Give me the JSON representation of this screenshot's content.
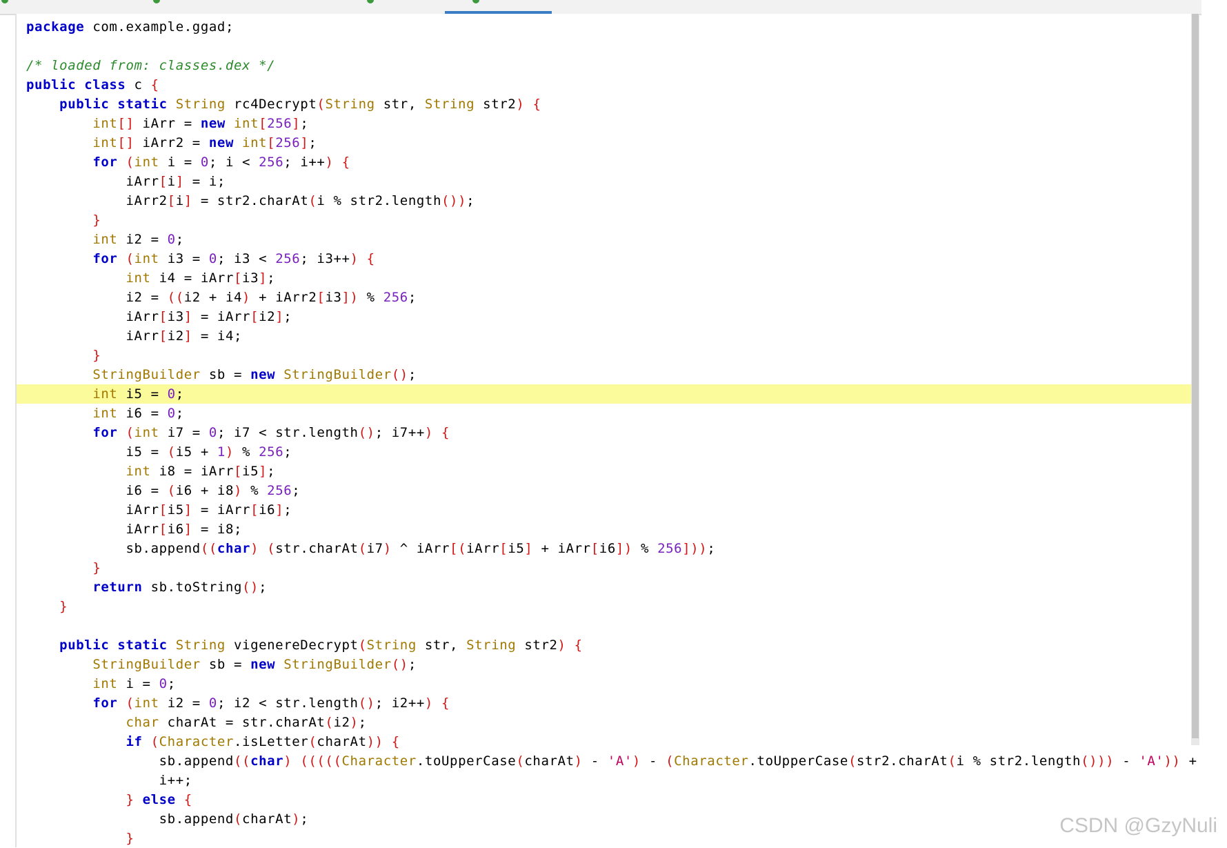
{
  "colors": {
    "keyword": "#0000c8",
    "type": "#a07800",
    "number": "#7a1fc2",
    "bracket": "#d21414",
    "string": "#c0005c",
    "comment": "#2b8a2b",
    "highlight": "#fbfb9c",
    "active_tab": "#3b7dc4"
  },
  "tabs": [
    {
      "icon": "class-file-icon",
      "active": false
    },
    {
      "icon": "class-file-icon",
      "active": false
    },
    {
      "icon": "class-file-icon",
      "active": false
    },
    {
      "icon": "class-file-icon",
      "active": true
    }
  ],
  "editor": {
    "highlighted_line": 20,
    "lines": [
      [
        [
          "kw",
          "package"
        ],
        [
          "plain",
          " com.example.ggad;"
        ]
      ],
      [],
      [
        [
          "cm",
          "/* loaded from: classes.dex */"
        ]
      ],
      [
        [
          "kw",
          "public class"
        ],
        [
          "plain",
          " c "
        ],
        [
          "br",
          "{"
        ]
      ],
      [
        [
          "plain",
          "    "
        ],
        [
          "kw",
          "public static"
        ],
        [
          "plain",
          " "
        ],
        [
          "ty",
          "String"
        ],
        [
          "plain",
          " rc4Decrypt"
        ],
        [
          "br",
          "("
        ],
        [
          "ty",
          "String"
        ],
        [
          "plain",
          " str, "
        ],
        [
          "ty",
          "String"
        ],
        [
          "plain",
          " str2"
        ],
        [
          "br",
          ")"
        ],
        [
          "plain",
          " "
        ],
        [
          "br",
          "{"
        ]
      ],
      [
        [
          "plain",
          "        "
        ],
        [
          "ty",
          "int"
        ],
        [
          "br",
          "[]"
        ],
        [
          "plain",
          " iArr = "
        ],
        [
          "kw",
          "new"
        ],
        [
          "plain",
          " "
        ],
        [
          "ty",
          "int"
        ],
        [
          "br",
          "["
        ],
        [
          "num",
          "256"
        ],
        [
          "br",
          "]"
        ],
        [
          "plain",
          ";"
        ]
      ],
      [
        [
          "plain",
          "        "
        ],
        [
          "ty",
          "int"
        ],
        [
          "br",
          "[]"
        ],
        [
          "plain",
          " iArr2 = "
        ],
        [
          "kw",
          "new"
        ],
        [
          "plain",
          " "
        ],
        [
          "ty",
          "int"
        ],
        [
          "br",
          "["
        ],
        [
          "num",
          "256"
        ],
        [
          "br",
          "]"
        ],
        [
          "plain",
          ";"
        ]
      ],
      [
        [
          "plain",
          "        "
        ],
        [
          "kw",
          "for"
        ],
        [
          "plain",
          " "
        ],
        [
          "br",
          "("
        ],
        [
          "ty",
          "int"
        ],
        [
          "plain",
          " i = "
        ],
        [
          "num",
          "0"
        ],
        [
          "plain",
          "; i < "
        ],
        [
          "num",
          "256"
        ],
        [
          "plain",
          "; i++"
        ],
        [
          "br",
          ")"
        ],
        [
          "plain",
          " "
        ],
        [
          "br",
          "{"
        ]
      ],
      [
        [
          "plain",
          "            iArr"
        ],
        [
          "br",
          "["
        ],
        [
          "plain",
          "i"
        ],
        [
          "br",
          "]"
        ],
        [
          "plain",
          " = i;"
        ]
      ],
      [
        [
          "plain",
          "            iArr2"
        ],
        [
          "br",
          "["
        ],
        [
          "plain",
          "i"
        ],
        [
          "br",
          "]"
        ],
        [
          "plain",
          " = str2.charAt"
        ],
        [
          "br",
          "("
        ],
        [
          "plain",
          "i % str2.length"
        ],
        [
          "br",
          "())"
        ],
        [
          "plain",
          ";"
        ]
      ],
      [
        [
          "plain",
          "        "
        ],
        [
          "br",
          "}"
        ]
      ],
      [
        [
          "plain",
          "        "
        ],
        [
          "ty",
          "int"
        ],
        [
          "plain",
          " i2 = "
        ],
        [
          "num",
          "0"
        ],
        [
          "plain",
          ";"
        ]
      ],
      [
        [
          "plain",
          "        "
        ],
        [
          "kw",
          "for"
        ],
        [
          "plain",
          " "
        ],
        [
          "br",
          "("
        ],
        [
          "ty",
          "int"
        ],
        [
          "plain",
          " i3 = "
        ],
        [
          "num",
          "0"
        ],
        [
          "plain",
          "; i3 < "
        ],
        [
          "num",
          "256"
        ],
        [
          "plain",
          "; i3++"
        ],
        [
          "br",
          ")"
        ],
        [
          "plain",
          " "
        ],
        [
          "br",
          "{"
        ]
      ],
      [
        [
          "plain",
          "            "
        ],
        [
          "ty",
          "int"
        ],
        [
          "plain",
          " i4 = iArr"
        ],
        [
          "br",
          "["
        ],
        [
          "plain",
          "i3"
        ],
        [
          "br",
          "]"
        ],
        [
          "plain",
          ";"
        ]
      ],
      [
        [
          "plain",
          "            i2 = "
        ],
        [
          "br",
          "(("
        ],
        [
          "plain",
          "i2 + i4"
        ],
        [
          "br",
          ")"
        ],
        [
          "plain",
          " + iArr2"
        ],
        [
          "br",
          "["
        ],
        [
          "plain",
          "i3"
        ],
        [
          "br",
          "])"
        ],
        [
          "plain",
          " % "
        ],
        [
          "num",
          "256"
        ],
        [
          "plain",
          ";"
        ]
      ],
      [
        [
          "plain",
          "            iArr"
        ],
        [
          "br",
          "["
        ],
        [
          "plain",
          "i3"
        ],
        [
          "br",
          "]"
        ],
        [
          "plain",
          " = iArr"
        ],
        [
          "br",
          "["
        ],
        [
          "plain",
          "i2"
        ],
        [
          "br",
          "]"
        ],
        [
          "plain",
          ";"
        ]
      ],
      [
        [
          "plain",
          "            iArr"
        ],
        [
          "br",
          "["
        ],
        [
          "plain",
          "i2"
        ],
        [
          "br",
          "]"
        ],
        [
          "plain",
          " = i4;"
        ]
      ],
      [
        [
          "plain",
          "        "
        ],
        [
          "br",
          "}"
        ]
      ],
      [
        [
          "plain",
          "        "
        ],
        [
          "ty",
          "StringBuilder"
        ],
        [
          "plain",
          " sb = "
        ],
        [
          "kw",
          "new"
        ],
        [
          "plain",
          " "
        ],
        [
          "ty",
          "StringBuilder"
        ],
        [
          "br",
          "()"
        ],
        [
          "plain",
          ";"
        ]
      ],
      [
        [
          "plain",
          "        "
        ],
        [
          "ty",
          "int"
        ],
        [
          "plain",
          " i5 = "
        ],
        [
          "num",
          "0"
        ],
        [
          "plain",
          ";"
        ]
      ],
      [
        [
          "plain",
          "        "
        ],
        [
          "ty",
          "int"
        ],
        [
          "plain",
          " i6 = "
        ],
        [
          "num",
          "0"
        ],
        [
          "plain",
          ";"
        ]
      ],
      [
        [
          "plain",
          "        "
        ],
        [
          "kw",
          "for"
        ],
        [
          "plain",
          " "
        ],
        [
          "br",
          "("
        ],
        [
          "ty",
          "int"
        ],
        [
          "plain",
          " i7 = "
        ],
        [
          "num",
          "0"
        ],
        [
          "plain",
          "; i7 < str.length"
        ],
        [
          "br",
          "()"
        ],
        [
          "plain",
          "; i7++"
        ],
        [
          "br",
          ")"
        ],
        [
          "plain",
          " "
        ],
        [
          "br",
          "{"
        ]
      ],
      [
        [
          "plain",
          "            i5 = "
        ],
        [
          "br",
          "("
        ],
        [
          "plain",
          "i5 + "
        ],
        [
          "num",
          "1"
        ],
        [
          "br",
          ")"
        ],
        [
          "plain",
          " % "
        ],
        [
          "num",
          "256"
        ],
        [
          "plain",
          ";"
        ]
      ],
      [
        [
          "plain",
          "            "
        ],
        [
          "ty",
          "int"
        ],
        [
          "plain",
          " i8 = iArr"
        ],
        [
          "br",
          "["
        ],
        [
          "plain",
          "i5"
        ],
        [
          "br",
          "]"
        ],
        [
          "plain",
          ";"
        ]
      ],
      [
        [
          "plain",
          "            i6 = "
        ],
        [
          "br",
          "("
        ],
        [
          "plain",
          "i6 + i8"
        ],
        [
          "br",
          ")"
        ],
        [
          "plain",
          " % "
        ],
        [
          "num",
          "256"
        ],
        [
          "plain",
          ";"
        ]
      ],
      [
        [
          "plain",
          "            iArr"
        ],
        [
          "br",
          "["
        ],
        [
          "plain",
          "i5"
        ],
        [
          "br",
          "]"
        ],
        [
          "plain",
          " = iArr"
        ],
        [
          "br",
          "["
        ],
        [
          "plain",
          "i6"
        ],
        [
          "br",
          "]"
        ],
        [
          "plain",
          ";"
        ]
      ],
      [
        [
          "plain",
          "            iArr"
        ],
        [
          "br",
          "["
        ],
        [
          "plain",
          "i6"
        ],
        [
          "br",
          "]"
        ],
        [
          "plain",
          " = i8;"
        ]
      ],
      [
        [
          "plain",
          "            sb.append"
        ],
        [
          "br",
          "(("
        ],
        [
          "kw",
          "char"
        ],
        [
          "br",
          ")"
        ],
        [
          "plain",
          " "
        ],
        [
          "br",
          "("
        ],
        [
          "plain",
          "str.charAt"
        ],
        [
          "br",
          "("
        ],
        [
          "plain",
          "i7"
        ],
        [
          "br",
          ")"
        ],
        [
          "plain",
          " ^ iArr"
        ],
        [
          "br",
          "[("
        ],
        [
          "plain",
          "iArr"
        ],
        [
          "br",
          "["
        ],
        [
          "plain",
          "i5"
        ],
        [
          "br",
          "]"
        ],
        [
          "plain",
          " + iArr"
        ],
        [
          "br",
          "["
        ],
        [
          "plain",
          "i6"
        ],
        [
          "br",
          "])"
        ],
        [
          "plain",
          " % "
        ],
        [
          "num",
          "256"
        ],
        [
          "br",
          "]))"
        ],
        [
          "plain",
          ";"
        ]
      ],
      [
        [
          "plain",
          "        "
        ],
        [
          "br",
          "}"
        ]
      ],
      [
        [
          "plain",
          "        "
        ],
        [
          "kw",
          "return"
        ],
        [
          "plain",
          " sb.toString"
        ],
        [
          "br",
          "()"
        ],
        [
          "plain",
          ";"
        ]
      ],
      [
        [
          "plain",
          "    "
        ],
        [
          "br",
          "}"
        ]
      ],
      [],
      [
        [
          "plain",
          "    "
        ],
        [
          "kw",
          "public static"
        ],
        [
          "plain",
          " "
        ],
        [
          "ty",
          "String"
        ],
        [
          "plain",
          " vigenereDecrypt"
        ],
        [
          "br",
          "("
        ],
        [
          "ty",
          "String"
        ],
        [
          "plain",
          " str, "
        ],
        [
          "ty",
          "String"
        ],
        [
          "plain",
          " str2"
        ],
        [
          "br",
          ")"
        ],
        [
          "plain",
          " "
        ],
        [
          "br",
          "{"
        ]
      ],
      [
        [
          "plain",
          "        "
        ],
        [
          "ty",
          "StringBuilder"
        ],
        [
          "plain",
          " sb = "
        ],
        [
          "kw",
          "new"
        ],
        [
          "plain",
          " "
        ],
        [
          "ty",
          "StringBuilder"
        ],
        [
          "br",
          "()"
        ],
        [
          "plain",
          ";"
        ]
      ],
      [
        [
          "plain",
          "        "
        ],
        [
          "ty",
          "int"
        ],
        [
          "plain",
          " i = "
        ],
        [
          "num",
          "0"
        ],
        [
          "plain",
          ";"
        ]
      ],
      [
        [
          "plain",
          "        "
        ],
        [
          "kw",
          "for"
        ],
        [
          "plain",
          " "
        ],
        [
          "br",
          "("
        ],
        [
          "ty",
          "int"
        ],
        [
          "plain",
          " i2 = "
        ],
        [
          "num",
          "0"
        ],
        [
          "plain",
          "; i2 < str.length"
        ],
        [
          "br",
          "()"
        ],
        [
          "plain",
          "; i2++"
        ],
        [
          "br",
          ")"
        ],
        [
          "plain",
          " "
        ],
        [
          "br",
          "{"
        ]
      ],
      [
        [
          "plain",
          "            "
        ],
        [
          "ty",
          "char"
        ],
        [
          "plain",
          " charAt = str.charAt"
        ],
        [
          "br",
          "("
        ],
        [
          "plain",
          "i2"
        ],
        [
          "br",
          ")"
        ],
        [
          "plain",
          ";"
        ]
      ],
      [
        [
          "plain",
          "            "
        ],
        [
          "kw",
          "if"
        ],
        [
          "plain",
          " "
        ],
        [
          "br",
          "("
        ],
        [
          "ty",
          "Character"
        ],
        [
          "plain",
          ".isLetter"
        ],
        [
          "br",
          "("
        ],
        [
          "plain",
          "charAt"
        ],
        [
          "br",
          "))"
        ],
        [
          "plain",
          " "
        ],
        [
          "br",
          "{"
        ]
      ],
      [
        [
          "plain",
          "                sb.append"
        ],
        [
          "br",
          "(("
        ],
        [
          "kw",
          "char"
        ],
        [
          "br",
          ")"
        ],
        [
          "plain",
          " "
        ],
        [
          "br",
          "((((("
        ],
        [
          "ty",
          "Character"
        ],
        [
          "plain",
          ".toUpperCase"
        ],
        [
          "br",
          "("
        ],
        [
          "plain",
          "charAt"
        ],
        [
          "br",
          ")"
        ],
        [
          "plain",
          " - "
        ],
        [
          "str",
          "'A'"
        ],
        [
          "br",
          ")"
        ],
        [
          "plain",
          " - "
        ],
        [
          "br",
          "("
        ],
        [
          "ty",
          "Character"
        ],
        [
          "plain",
          ".toUpperCase"
        ],
        [
          "br",
          "("
        ],
        [
          "plain",
          "str2.charAt"
        ],
        [
          "br",
          "("
        ],
        [
          "plain",
          "i % str2.length"
        ],
        [
          "br",
          "()))"
        ],
        [
          "plain",
          " - "
        ],
        [
          "str",
          "'A'"
        ],
        [
          "br",
          "))"
        ],
        [
          "plain",
          " +"
        ]
      ],
      [
        [
          "plain",
          "                i++;"
        ]
      ],
      [
        [
          "plain",
          "            "
        ],
        [
          "br",
          "}"
        ],
        [
          "plain",
          " "
        ],
        [
          "kw",
          "else"
        ],
        [
          "plain",
          " "
        ],
        [
          "br",
          "{"
        ]
      ],
      [
        [
          "plain",
          "                sb.append"
        ],
        [
          "br",
          "("
        ],
        [
          "plain",
          "charAt"
        ],
        [
          "br",
          ")"
        ],
        [
          "plain",
          ";"
        ]
      ],
      [
        [
          "plain",
          "            "
        ],
        [
          "br",
          "}"
        ]
      ]
    ]
  },
  "watermark": "CSDN @GzyNuli"
}
